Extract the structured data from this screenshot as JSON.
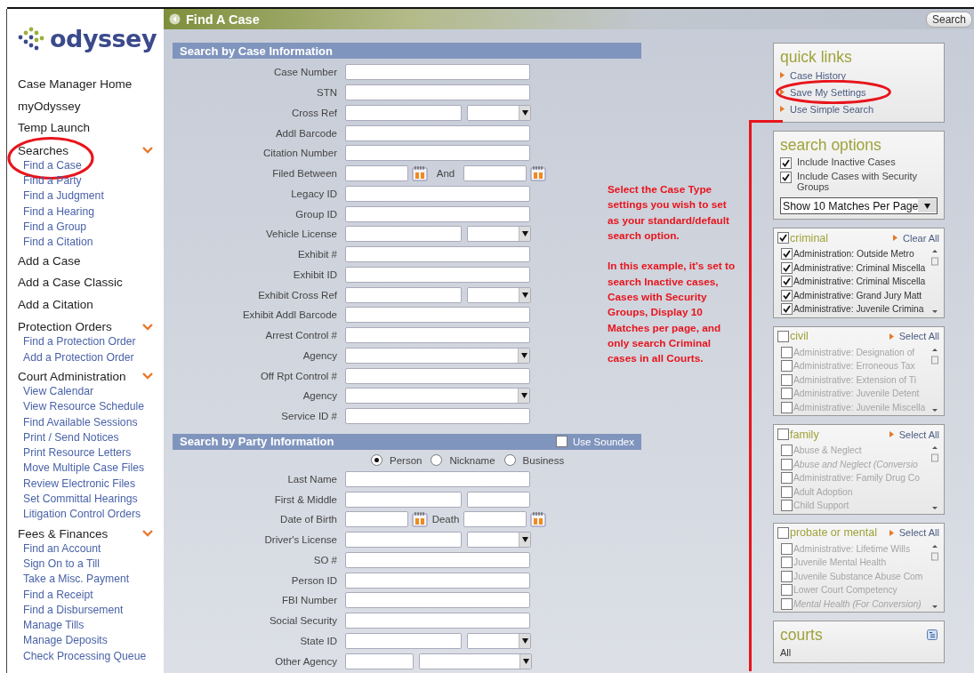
{
  "sidebar": {
    "logo": "odyssey",
    "groups": [
      {
        "label": "Case Manager Home"
      },
      {
        "label": "myOdyssey"
      },
      {
        "label": "Temp Launch"
      },
      {
        "label": "Searches",
        "expanded": true,
        "children": [
          {
            "label": "Find a Case",
            "circled": true
          },
          {
            "label": "Find a Party",
            "circled": false
          },
          {
            "label": "Find a Judgment",
            "circled": false
          },
          {
            "label": "Find a Hearing",
            "circled": false
          },
          {
            "label": "Find a Group",
            "circled": false
          },
          {
            "label": "Find a Citation",
            "circled": false
          }
        ]
      },
      {
        "label": "Add a Case"
      },
      {
        "label": "Add a Case Classic"
      },
      {
        "label": "Add a Citation"
      },
      {
        "label": "Protection Orders",
        "expanded": true,
        "children": [
          {
            "label": "Find a Protection Order",
            "circled": false
          },
          {
            "label": "Add a Protection Order",
            "circled": false
          }
        ]
      },
      {
        "label": "Court Administration",
        "expanded": true,
        "children": [
          {
            "label": "View Calendar",
            "circled": false
          },
          {
            "label": "View Resource Schedule",
            "circled": false
          },
          {
            "label": "Find Available Sessions",
            "circled": false
          },
          {
            "label": "Print / Send Notices",
            "circled": false
          },
          {
            "label": "Print Resource Letters",
            "circled": false
          },
          {
            "label": "Move Multiple Case Files",
            "circled": false
          },
          {
            "label": "Review Electronic Files",
            "circled": false
          },
          {
            "label": "Set Committal Hearings",
            "circled": false
          },
          {
            "label": "Litigation Control Orders",
            "circled": false
          }
        ]
      },
      {
        "label": "Fees & Finances",
        "expanded": true,
        "children": [
          {
            "label": "Find an Account",
            "circled": false
          },
          {
            "label": "Sign On to a Till",
            "circled": false
          },
          {
            "label": "Take a Misc. Payment",
            "circled": false
          },
          {
            "label": "Find a Receipt",
            "circled": false
          },
          {
            "label": "Find a Disbursement",
            "circled": false
          },
          {
            "label": "Manage Tills",
            "circled": false
          },
          {
            "label": "Manage Deposits",
            "circled": false
          },
          {
            "label": "Check Processing Queue",
            "circled": false
          }
        ]
      }
    ]
  },
  "header": {
    "title": "Find A Case",
    "search_button": "Search"
  },
  "case_section": {
    "title": "Search by Case Information",
    "rows": [
      {
        "label": "Case Number",
        "kind": "text"
      },
      {
        "label": "STN",
        "kind": "text"
      },
      {
        "label": "Cross Ref",
        "kind": "text_select"
      },
      {
        "label": "Addl Barcode",
        "kind": "text"
      },
      {
        "label": "Citation Number",
        "kind": "text"
      },
      {
        "label": "Filed Between",
        "kind": "date_range",
        "second_label": "And"
      },
      {
        "label": "Legacy ID",
        "kind": "text"
      },
      {
        "label": "Group ID",
        "kind": "text"
      },
      {
        "label": "Vehicle License",
        "kind": "text_select"
      },
      {
        "label": "Exhibit #",
        "kind": "text"
      },
      {
        "label": "Exhibit ID",
        "kind": "text"
      },
      {
        "label": "Exhibit Cross Ref",
        "kind": "text_select"
      },
      {
        "label": "Exhibit Addl Barcode",
        "kind": "text"
      },
      {
        "label": "Arrest Control #",
        "kind": "text"
      },
      {
        "label": "Agency",
        "kind": "select"
      },
      {
        "label": "Off Rpt Control #",
        "kind": "text"
      },
      {
        "label": "Agency",
        "kind": "select"
      },
      {
        "label": "Service ID #",
        "kind": "text"
      }
    ]
  },
  "party_section": {
    "title": "Search by Party Information",
    "soundex": {
      "label": "Use Soundex",
      "checked": false
    },
    "radios": [
      {
        "label": "Person",
        "selected": true
      },
      {
        "label": "Nickname",
        "selected": false
      },
      {
        "label": "Business",
        "selected": false
      }
    ],
    "rows": [
      {
        "label": "Last Name",
        "kind": "text"
      },
      {
        "label": "First & Middle",
        "kind": "two_text"
      },
      {
        "label": "Date of Birth",
        "kind": "date_range",
        "second_label": "Death"
      },
      {
        "label": "Driver's License",
        "kind": "text_select"
      },
      {
        "label": "SO #",
        "kind": "text"
      },
      {
        "label": "Person ID",
        "kind": "text"
      },
      {
        "label": "FBI Number",
        "kind": "text"
      },
      {
        "label": "Social Security",
        "kind": "text"
      },
      {
        "label": "State ID",
        "kind": "text_select"
      },
      {
        "label": "Other Agency",
        "kind": "short_select"
      }
    ]
  },
  "note": {
    "paragraphs": [
      "Select the Case Type settings you wish to set as your standard/default search option.",
      "In this example, it's set to search Inactive cases, Cases with Security Groups, Display 10 Matches per page, and only search Criminal cases in all Courts."
    ],
    "bracket": true
  },
  "quick_links": {
    "title": "quick links",
    "links": [
      {
        "label": "Case History",
        "circled": false
      },
      {
        "label": "Save My Settings",
        "circled": true
      },
      {
        "label": "Use Simple Search",
        "circled": false
      }
    ]
  },
  "search_options": {
    "title": "search options",
    "options": [
      {
        "label": "Include Inactive Cases",
        "checked": true
      },
      {
        "label": "Include Cases with Security Groups",
        "checked": true
      }
    ],
    "page_size": "Show 10 Matches Per Page"
  },
  "case_types": [
    {
      "title": "criminal",
      "checked": true,
      "action": "Clear All",
      "items": [
        {
          "label": "Administration: Outside Metro",
          "checked": true,
          "conversion": false
        },
        {
          "label": "Administrative: Criminal Miscella",
          "checked": true,
          "conversion": false
        },
        {
          "label": "Administrative: Criminal Miscella",
          "checked": true,
          "conversion": false
        },
        {
          "label": "Administrative: Grand Jury Matt",
          "checked": true,
          "conversion": false
        },
        {
          "label": "Administrative: Juvenile Crimina",
          "checked": true,
          "conversion": false
        }
      ]
    },
    {
      "title": "civil",
      "checked": false,
      "action": "Select All",
      "items": [
        {
          "label": "Administrative: Designation of",
          "checked": false,
          "conversion": false
        },
        {
          "label": "Administrative: Erroneous Tax",
          "checked": false,
          "conversion": false
        },
        {
          "label": "Administrative: Extension of Ti",
          "checked": false,
          "conversion": false
        },
        {
          "label": "Administrative: Juvenile Detent",
          "checked": false,
          "conversion": false
        },
        {
          "label": "Administrative: Juvenile Miscella",
          "checked": false,
          "conversion": false
        }
      ]
    },
    {
      "title": "family",
      "checked": false,
      "action": "Select All",
      "items": [
        {
          "label": "Abuse & Neglect",
          "checked": false,
          "conversion": false
        },
        {
          "label": "Abuse and Neglect (Conversio",
          "checked": false,
          "conversion": true
        },
        {
          "label": "Administrative: Family Drug Co",
          "checked": false,
          "conversion": false
        },
        {
          "label": "Adult Adoption",
          "checked": false,
          "conversion": false
        },
        {
          "label": "Child Support",
          "checked": false,
          "conversion": false
        }
      ]
    },
    {
      "title": "probate or mental",
      "checked": false,
      "action": "Select All",
      "items": [
        {
          "label": "Administrative: Lifetime Wills",
          "checked": false,
          "conversion": false
        },
        {
          "label": "Juvenile Mental Health",
          "checked": false,
          "conversion": false
        },
        {
          "label": "Juvenile Substance Abuse Com",
          "checked": false,
          "conversion": false
        },
        {
          "label": "Lower Court Competency",
          "checked": false,
          "conversion": false
        },
        {
          "label": "Mental Health (For Conversion)",
          "checked": false,
          "conversion": true
        }
      ]
    }
  ],
  "courts": {
    "title": "courts",
    "value": "All"
  }
}
